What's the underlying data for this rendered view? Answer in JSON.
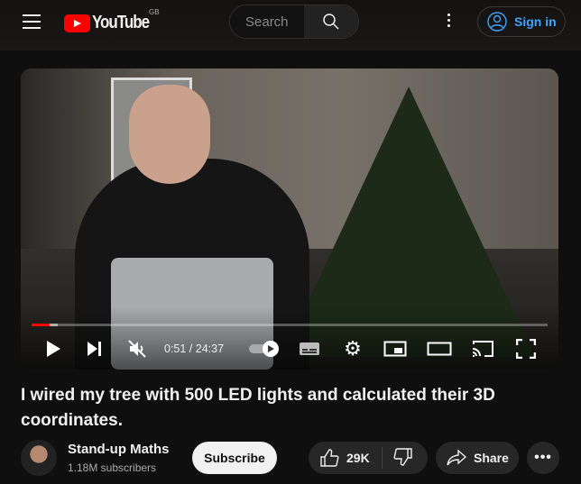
{
  "header": {
    "logo_text": "YouTube",
    "region": "GB",
    "search_placeholder": "Search",
    "sign_in": "Sign in"
  },
  "player": {
    "current_time": "0:51",
    "duration": "24:37",
    "time_display": "0:51 / 24:37",
    "progress_percent": 3.5,
    "muted": true,
    "autoplay": true
  },
  "video": {
    "title": "I wired my tree with 500 LED lights and calculated their 3D coordinates."
  },
  "channel": {
    "name": "Stand-up Maths",
    "subscribers": "1.18M subscribers",
    "subscribe_label": "Subscribe"
  },
  "actions": {
    "likes": "29K",
    "share": "Share"
  },
  "colors": {
    "brand": "#ff0000",
    "link": "#3ea6ff",
    "background": "#0f0f0f"
  }
}
